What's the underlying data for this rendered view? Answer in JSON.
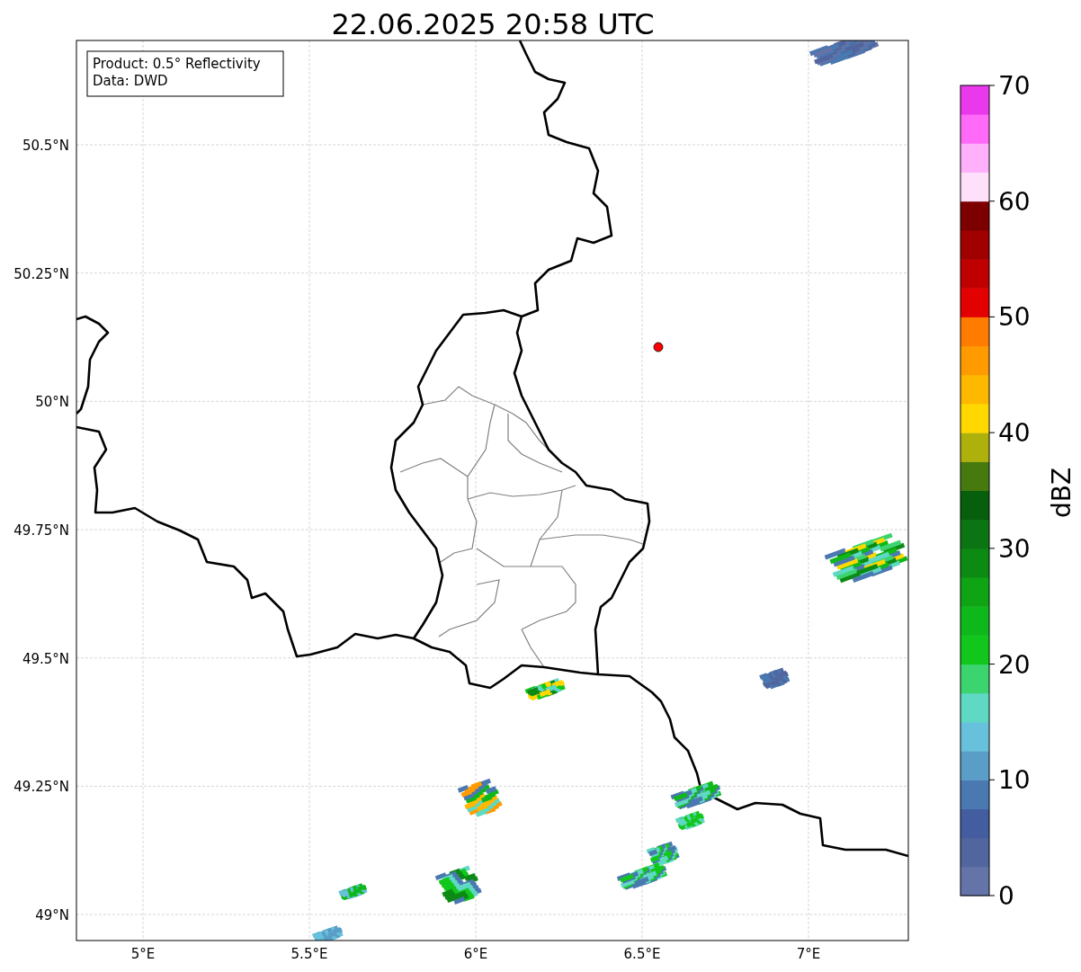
{
  "title": "22.06.2025 20:58 UTC",
  "info_box": [
    "Product: 0.5° Reflectivity",
    "Data: DWD"
  ],
  "lat_labels": [
    "50.5°N",
    "50.25°N",
    "50°N",
    "49.75°N",
    "49.5°N",
    "49.25°N",
    "49°N"
  ],
  "lon_labels": [
    "5°E",
    "5.5°E",
    "6°E",
    "6.5°E",
    "7°E"
  ],
  "colorbar": {
    "label": "dBZ",
    "ticks": [
      "70",
      "60",
      "50",
      "40",
      "30",
      "20",
      "10",
      "0"
    ],
    "bins": [
      {
        "color": "#6473a8"
      },
      {
        "color": "#51669e"
      },
      {
        "color": "#435da0"
      },
      {
        "color": "#4a78b0"
      },
      {
        "color": "#5a9ec8"
      },
      {
        "color": "#68c1dc"
      },
      {
        "color": "#5fd8c4"
      },
      {
        "color": "#3bd46e"
      },
      {
        "color": "#12c71c"
      },
      {
        "color": "#0fb81a"
      },
      {
        "color": "#0ea414"
      },
      {
        "color": "#0c8a14"
      },
      {
        "color": "#0b7413"
      },
      {
        "color": "#075e0c"
      },
      {
        "color": "#467a0e"
      },
      {
        "color": "#aeb10c"
      },
      {
        "color": "#ffd800"
      },
      {
        "color": "#ffb800"
      },
      {
        "color": "#ff9b00"
      },
      {
        "color": "#ff7c00"
      },
      {
        "color": "#e30000"
      },
      {
        "color": "#c00000"
      },
      {
        "color": "#a00000"
      },
      {
        "color": "#7c0000"
      },
      {
        "color": "#ffe0fa"
      },
      {
        "color": "#ffb0fa"
      },
      {
        "color": "#ff6af8"
      },
      {
        "color": "#ea38ec"
      }
    ]
  }
}
